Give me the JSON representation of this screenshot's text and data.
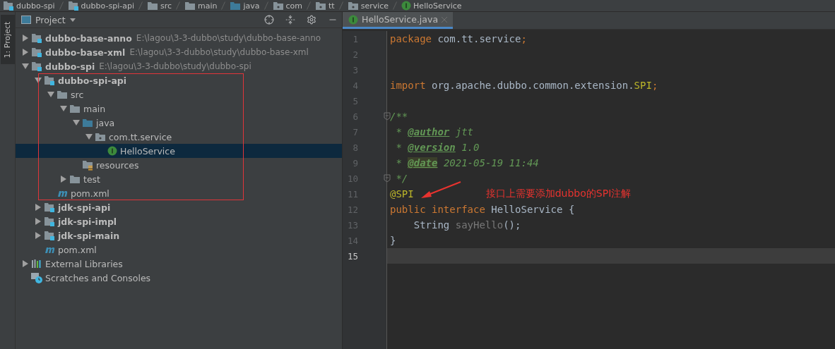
{
  "breadcrumb": [
    {
      "label": "dubbo-spi",
      "kind": "module"
    },
    {
      "label": "dubbo-spi-api",
      "kind": "module"
    },
    {
      "label": "src",
      "kind": "folder"
    },
    {
      "label": "main",
      "kind": "folder"
    },
    {
      "label": "java",
      "kind": "source"
    },
    {
      "label": "com",
      "kind": "package"
    },
    {
      "label": "tt",
      "kind": "package"
    },
    {
      "label": "service",
      "kind": "package"
    },
    {
      "label": "HelloService",
      "kind": "interface"
    }
  ],
  "side_tab": {
    "label": "1: Project"
  },
  "project_panel": {
    "title": "Project",
    "tree": [
      {
        "label": "dubbo-base-anno",
        "path": "E:\\lagou\\3-3-dubbo\\study\\dubbo-base-anno",
        "kind": "module",
        "expanded": false,
        "selected": false
      },
      {
        "label": "dubbo-base-xml",
        "path": "E:\\lagou\\3-3-dubbo\\study\\dubbo-base-xml",
        "kind": "module",
        "expanded": false,
        "selected": false
      },
      {
        "label": "dubbo-spi",
        "path": "E:\\lagou\\3-3-dubbo\\study\\dubbo-spi",
        "kind": "module",
        "expanded": true,
        "selected": false,
        "children": [
          {
            "label": "dubbo-spi-api",
            "kind": "module",
            "expanded": true,
            "selected": false,
            "annotated": true,
            "children": [
              {
                "label": "src",
                "kind": "folder",
                "expanded": true,
                "selected": false,
                "children": [
                  {
                    "label": "main",
                    "kind": "folder",
                    "expanded": true,
                    "selected": false,
                    "children": [
                      {
                        "label": "java",
                        "kind": "source",
                        "expanded": true,
                        "selected": false,
                        "children": [
                          {
                            "label": "com.tt.service",
                            "kind": "package",
                            "expanded": true,
                            "selected": false,
                            "children": [
                              {
                                "label": "HelloService",
                                "kind": "interface",
                                "selected": true
                              }
                            ]
                          }
                        ]
                      },
                      {
                        "label": "resources",
                        "kind": "resources",
                        "selected": false
                      }
                    ]
                  },
                  {
                    "label": "test",
                    "kind": "folder",
                    "expanded": false,
                    "selected": false
                  }
                ]
              },
              {
                "label": "pom.xml",
                "kind": "maven",
                "selected": false
              }
            ]
          },
          {
            "label": "jdk-spi-api",
            "kind": "module",
            "expanded": false,
            "selected": false
          },
          {
            "label": "jdk-spi-impl",
            "kind": "module",
            "expanded": false,
            "selected": false
          },
          {
            "label": "jdk-spi-main",
            "kind": "module",
            "expanded": false,
            "selected": false
          },
          {
            "label": "pom.xml",
            "kind": "maven",
            "selected": false
          }
        ]
      },
      {
        "label": "External Libraries",
        "kind": "libraries",
        "expanded": false,
        "selected": false
      },
      {
        "label": "Scratches and Consoles",
        "kind": "scratches",
        "selected": false
      }
    ]
  },
  "editor": {
    "tabs": [
      {
        "label": "HelloService.java",
        "selected": true
      }
    ],
    "lines": [
      {
        "number": "1",
        "tokens": [
          {
            "text": "package ",
            "kind": "keyword"
          },
          {
            "text": "com.tt.service",
            "kind": "plain"
          },
          {
            "text": ";",
            "kind": "keyword"
          }
        ]
      },
      {
        "number": "2"
      },
      {
        "number": "3"
      },
      {
        "number": "4",
        "tokens": [
          {
            "text": "import ",
            "kind": "keyword"
          },
          {
            "text": "org.apache.dubbo.common.extension.",
            "kind": "plain"
          },
          {
            "text": "SPI",
            "kind": "annotation"
          },
          {
            "text": ";",
            "kind": "keyword"
          }
        ]
      },
      {
        "number": "5"
      },
      {
        "number": "6",
        "fold": true,
        "tokens": [
          {
            "text": "/**",
            "kind": "comment"
          }
        ]
      },
      {
        "number": "7",
        "tokens": [
          {
            "text": " * ",
            "kind": "comment"
          },
          {
            "text": "@author",
            "kind": "doctag"
          },
          {
            "text": " jtt",
            "kind": "comment"
          }
        ]
      },
      {
        "number": "8",
        "tokens": [
          {
            "text": " * ",
            "kind": "comment"
          },
          {
            "text": "@version",
            "kind": "doctag"
          },
          {
            "text": " 1.0",
            "kind": "comment"
          }
        ]
      },
      {
        "number": "9",
        "tokens": [
          {
            "text": " * ",
            "kind": "comment"
          },
          {
            "text": "@date",
            "kind": "doctag-hit"
          },
          {
            "text": " 2021-05-19 11:44",
            "kind": "comment"
          }
        ]
      },
      {
        "number": "10",
        "fold": true,
        "tokens": [
          {
            "text": " */",
            "kind": "comment"
          }
        ]
      },
      {
        "number": "11",
        "tokens": [
          {
            "text": "@SPI",
            "kind": "annotation"
          }
        ],
        "note": "接口上需要添加dubbo的SPI注解"
      },
      {
        "number": "12",
        "tokens": [
          {
            "text": "public ",
            "kind": "keyword"
          },
          {
            "text": "interface ",
            "kind": "keyword"
          },
          {
            "text": "HelloService {",
            "kind": "plain"
          }
        ]
      },
      {
        "number": "13",
        "tokens": [
          {
            "text": "    String ",
            "kind": "plain"
          },
          {
            "text": "sayHello",
            "kind": "unused"
          },
          {
            "text": "();",
            "kind": "plain"
          }
        ]
      },
      {
        "number": "14",
        "tokens": [
          {
            "text": "}",
            "kind": "plain"
          }
        ]
      },
      {
        "number": "15",
        "current": true
      }
    ]
  }
}
